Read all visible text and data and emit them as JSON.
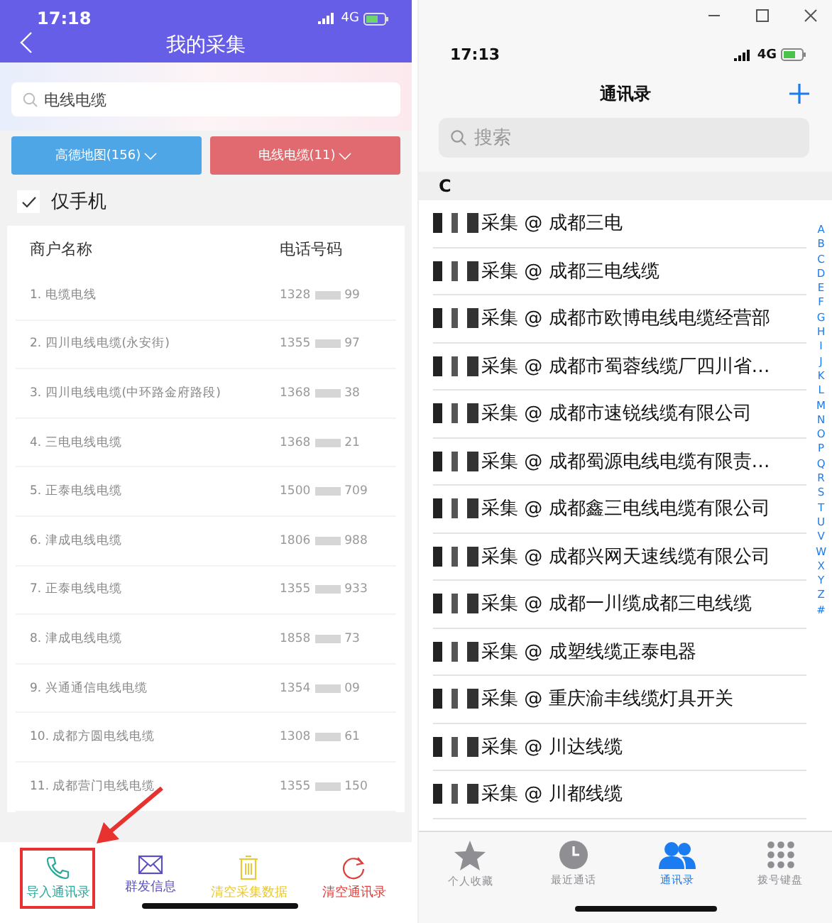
{
  "left_screen": {
    "status_bar": {
      "time": "17:18",
      "network": "4G"
    },
    "title": "我的采集",
    "search": {
      "value": "电线电缆"
    },
    "filters": [
      {
        "label": "高德地图(156)",
        "color": "#4ea6e6"
      },
      {
        "label": "电线电缆(11)",
        "color": "#e06a6f"
      }
    ],
    "only_mobile": {
      "label": "仅手机",
      "checked": true
    },
    "table": {
      "columns": [
        "商户名称",
        "电话号码"
      ],
      "rows": [
        {
          "name": "1. 电缆电线",
          "phone_start": "1328",
          "phone_end": "99"
        },
        {
          "name": "2. 四川电线电缆(永安街)",
          "phone_start": "1355",
          "phone_end": "97"
        },
        {
          "name": "3. 四川电线电缆(中环路金府路段)",
          "phone_start": "1368",
          "phone_end": "38"
        },
        {
          "name": "4. 三电电线电缆",
          "phone_start": "1368",
          "phone_end": "21"
        },
        {
          "name": "5. 正泰电线电缆",
          "phone_start": "1500",
          "phone_end": "709"
        },
        {
          "name": "6. 津成电线电缆",
          "phone_start": "1806",
          "phone_end": "988"
        },
        {
          "name": "7. 正泰电线电缆",
          "phone_start": "1355",
          "phone_end": "933"
        },
        {
          "name": "8. 津成电线电缆",
          "phone_start": "1858",
          "phone_end": "73"
        },
        {
          "name": "9. 兴通通信电线电缆",
          "phone_start": "1354",
          "phone_end": "09"
        },
        {
          "name": "10. 成都方圆电线电缆",
          "phone_start": "1308",
          "phone_end": "61"
        },
        {
          "name": "11. 成都营门电线电缆",
          "phone_start": "1355",
          "phone_end": "150"
        }
      ]
    },
    "toolbar": [
      {
        "label": "导入通讯录",
        "kind": "phone",
        "color": "#2aa89a",
        "highlighted": true
      },
      {
        "label": "群发信息",
        "kind": "mail",
        "color": "#5b4fc4",
        "highlighted": false
      },
      {
        "label": "清空采集数据",
        "kind": "trash",
        "color": "#e8c93a",
        "highlighted": false
      },
      {
        "label": "清空通讯录",
        "kind": "refresh",
        "color": "#d9413f",
        "highlighted": false
      }
    ]
  },
  "right_screen": {
    "status_bar": {
      "time": "17:13",
      "network": "4G"
    },
    "title": "通讯录",
    "search": {
      "placeholder": "搜索"
    },
    "section": "C",
    "contacts": [
      "采集 @ 成都三电",
      "采集 @ 成都三电线缆",
      "采集 @ 成都市欧博电线电缆经营部",
      "采集 @ 成都市蜀蓉线缆厂四川省…",
      "采集 @ 成都市速锐线缆有限公司",
      "采集 @ 成都蜀源电线电缆有限责…",
      "采集 @ 成都鑫三电线电缆有限公司",
      "采集 @ 成都兴网天速线缆有限公司",
      "采集 @ 成都一川缆成都三电线缆",
      "采集 @ 成塑线缆正泰电器",
      "采集 @ 重庆渝丰线缆灯具开关",
      "采集 @ 川达线缆",
      "采集 @ 川都线缆"
    ],
    "index": [
      "A",
      "B",
      "C",
      "D",
      "E",
      "F",
      "G",
      "H",
      "I",
      "J",
      "K",
      "L",
      "M",
      "N",
      "O",
      "P",
      "Q",
      "R",
      "S",
      "T",
      "U",
      "V",
      "W",
      "X",
      "Y",
      "Z",
      "#"
    ],
    "tabs": [
      {
        "label": "个人收藏",
        "kind": "star",
        "selected": false
      },
      {
        "label": "最近通话",
        "kind": "clock",
        "selected": false
      },
      {
        "label": "通讯录",
        "kind": "people",
        "selected": true
      },
      {
        "label": "拨号键盘",
        "kind": "keypad",
        "selected": false
      }
    ]
  }
}
